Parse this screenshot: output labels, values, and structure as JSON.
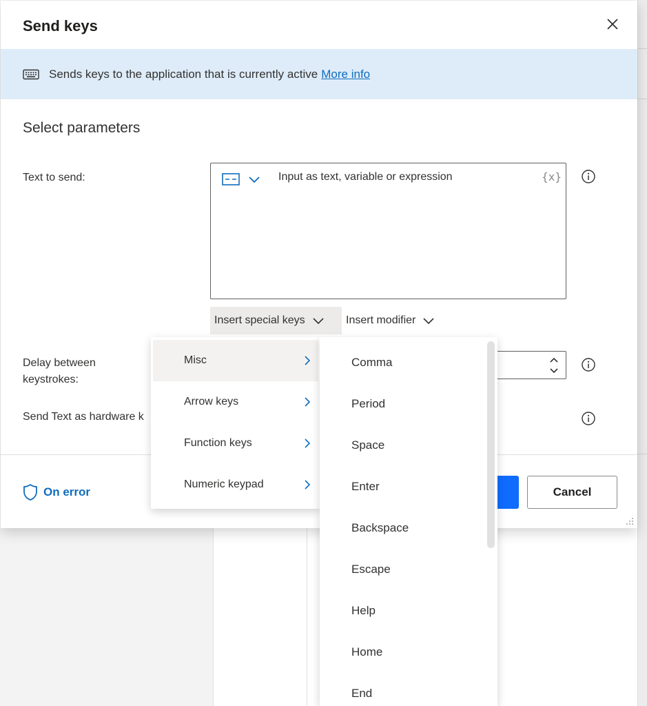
{
  "dialog": {
    "title": "Send keys",
    "close_icon": "close-icon"
  },
  "banner": {
    "icon": "keyboard-icon",
    "text": "Sends keys to the application that is currently active",
    "link": "More info",
    "background": "#deecf9"
  },
  "params": {
    "section_title": "Select parameters",
    "text_to_send_label": "Text to send:",
    "text_input_placeholder": "Input as text, variable or expression",
    "fx_label": "{x}",
    "insert_special_keys": "Insert special keys",
    "insert_modifier": "Insert modifier",
    "delay_label_line1": "Delay between",
    "delay_label_line2": "keystrokes:",
    "hardware_label": "Send Text as hardware k"
  },
  "footer": {
    "on_error": "On error",
    "cancel": "Cancel",
    "primary_color": "#0f6cff",
    "link_color": "#0f6cbd"
  },
  "menu": {
    "categories": [
      {
        "label": "Misc",
        "selected": true
      },
      {
        "label": "Arrow keys",
        "selected": false
      },
      {
        "label": "Function keys",
        "selected": false
      },
      {
        "label": "Numeric keypad",
        "selected": false
      }
    ],
    "keys": [
      "Comma",
      "Period",
      "Space",
      "Enter",
      "Backspace",
      "Escape",
      "Help",
      "Home",
      "End"
    ]
  }
}
